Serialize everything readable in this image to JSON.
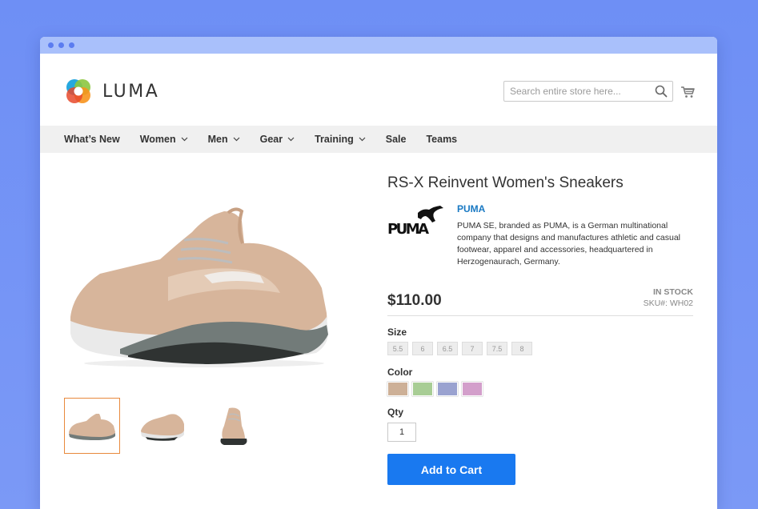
{
  "store": {
    "name": "LUMA",
    "search_placeholder": "Search entire store here..."
  },
  "nav": [
    {
      "label": "What’s New",
      "dropdown": false
    },
    {
      "label": "Women",
      "dropdown": true
    },
    {
      "label": "Men",
      "dropdown": true
    },
    {
      "label": "Gear",
      "dropdown": true
    },
    {
      "label": "Training",
      "dropdown": true
    },
    {
      "label": "Sale",
      "dropdown": false
    },
    {
      "label": "Teams",
      "dropdown": false
    }
  ],
  "product": {
    "title": "RS-X Reinvent Women's Sneakers",
    "brand": "PUMA",
    "brand_logo_text": "PUMA",
    "brand_description": "PUMA SE, branded as PUMA, is a German multinational company that designs and manufactures athletic and casual footwear, apparel and accessories, headquartered in Herzogenaurach, Germany.",
    "stock": "IN STOCK",
    "sku": "SKU#: WH02",
    "price": "$110.00",
    "size_label": "Size",
    "sizes": [
      "5.5",
      "6",
      "6.5",
      "7",
      "7.5",
      "8"
    ],
    "color_label": "Color",
    "colors": [
      "#cdb097",
      "#a8cd95",
      "#9aa2d0",
      "#d39fcb"
    ],
    "qty_label": "Qty",
    "qty": "1",
    "add_to_cart": "Add to Cart"
  },
  "colors": {
    "accent": "#1979f0",
    "brand_link": "#1979c3",
    "thumb_active_border": "#e8893c"
  }
}
